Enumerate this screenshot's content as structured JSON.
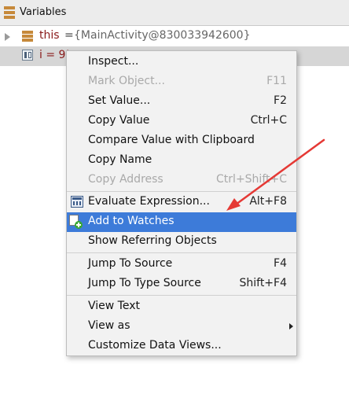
{
  "panel": {
    "title": "Variables"
  },
  "variables": [
    {
      "name": "this",
      "eq": " = ",
      "value": "{MainActivity@830033942600}",
      "icon": "object-icon"
    },
    {
      "text": "i = 9!",
      "icon": "primitive-icon"
    }
  ],
  "menu": {
    "items": [
      {
        "label": "Inspect...",
        "shortcut": ""
      },
      {
        "label": "Mark Object...",
        "shortcut": "F11",
        "disabled": true
      },
      {
        "label": "Set Value...",
        "shortcut": "F2"
      },
      {
        "label": "Copy Value",
        "shortcut": "Ctrl+C"
      },
      {
        "label": "Compare Value with Clipboard",
        "shortcut": ""
      },
      {
        "label": "Copy Name",
        "shortcut": ""
      },
      {
        "label": "Copy Address",
        "shortcut": "Ctrl+Shift+C",
        "disabled": true
      },
      {
        "label": "Evaluate Expression...",
        "shortcut": "Alt+F8",
        "icon": "calculator-icon"
      },
      {
        "label": "Add to Watches",
        "shortcut": "",
        "icon": "add-watch-icon",
        "selected": true
      },
      {
        "label": "Show Referring Objects",
        "shortcut": ""
      },
      {
        "label": "Jump To Source",
        "shortcut": "F4"
      },
      {
        "label": "Jump To Type Source",
        "shortcut": "Shift+F4"
      },
      {
        "label": "View Text",
        "shortcut": ""
      },
      {
        "label": "View as",
        "shortcut": "",
        "submenu": true
      },
      {
        "label": "Customize Data Views...",
        "shortcut": ""
      }
    ]
  },
  "colors": {
    "selection": "#3d7bd9",
    "annotation_arrow": "#e53935",
    "variable_name": "#8a1a1a",
    "disabled_text": "#a9a9a9"
  }
}
